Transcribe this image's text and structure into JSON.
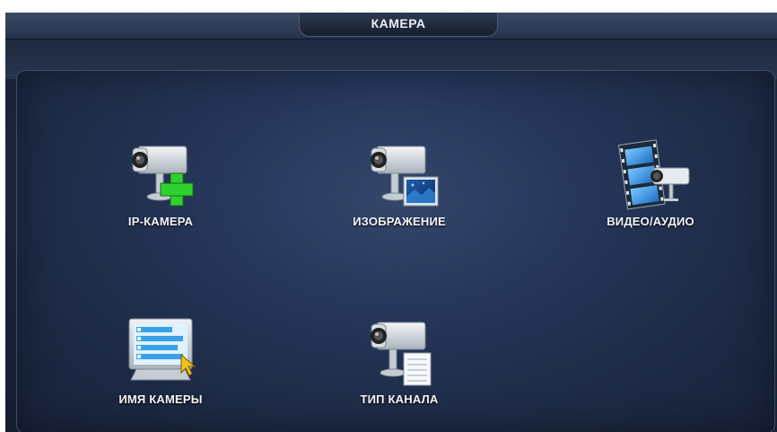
{
  "window": {
    "title": "КАМЕРА"
  },
  "menu": {
    "items": [
      {
        "label": "IP-КАМЕРА",
        "icon": "ip-camera-add-icon"
      },
      {
        "label": "ИЗОБРАЖЕНИЕ",
        "icon": "camera-image-icon"
      },
      {
        "label": "ВИДЕО/АУДИО",
        "icon": "video-audio-icon"
      },
      {
        "label": "ИМЯ КАМЕРЫ",
        "icon": "camera-name-icon"
      },
      {
        "label": "ТИП КАНАЛА",
        "icon": "channel-type-icon"
      }
    ]
  },
  "colors": {
    "background": "#1f2c44",
    "accent_green": "#2fd12f",
    "film_blue": "#3aa0e8"
  }
}
